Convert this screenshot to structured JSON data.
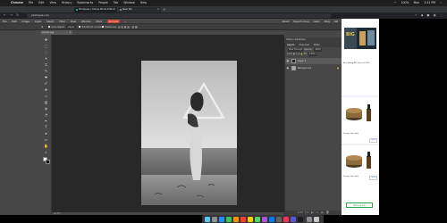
{
  "mac_menubar": {
    "apple": "",
    "items": [
      "Chrome",
      "File",
      "Edit",
      "View",
      "History",
      "Bookmarks",
      "People",
      "Tab",
      "Window",
      "Help"
    ],
    "right_items": [
      "100%",
      "Mon",
      "2:41 PM"
    ]
  },
  "browser": {
    "tabs": [
      {
        "title": "Photopea | Online Photo Editor"
      },
      {
        "title": "New Tab"
      }
    ],
    "url": "photopea.com",
    "colors": {
      "tab_active": "#202124",
      "chrome_dark": "#35363a"
    }
  },
  "photopea": {
    "menu": [
      "File",
      "Edit",
      "Image",
      "Layer",
      "Select",
      "Filter",
      "View",
      "Window",
      "More",
      "Account"
    ],
    "menu_highlighted": "Account",
    "menu_right": [
      "About",
      "Report a bug",
      "Learn",
      "Blog",
      "API"
    ],
    "options": {
      "auto_select": "Auto-Select",
      "layer": "Layer",
      "transform_controls": "Transform controls",
      "distances": "Distances"
    },
    "document_tab": "woman.jpg",
    "panel_tabs": [
      "Layers",
      "Channels",
      "Paths"
    ],
    "side_strip": "History  Swatches",
    "blend_mode": "Pass Through",
    "opacity_label": "Opacity:",
    "opacity_value": "100%",
    "lock_label": "Lock:",
    "fill_label": "Fill:",
    "fill_value": "100%",
    "layers": [
      {
        "name": "Layer 1"
      },
      {
        "name": "Background"
      }
    ],
    "status": "41.3%",
    "accent_color": "#c83f2e",
    "panel_bottom_icons": "eff fx ◐ ▭ ▤ 🗑"
  },
  "ads": {
    "top_caption": "Best Selling BRC Items of 2020",
    "ad1_caption": "Lussory Luxe Skin",
    "ad1_button": "Open",
    "ad2_caption": "Lussory Luxe Skin",
    "ad2_button": "Open",
    "green_button": "Remove Ads"
  },
  "icons": {
    "tools": [
      "move-icon",
      "marquee-icon",
      "lasso-icon",
      "magic-wand-icon",
      "crop-icon",
      "eyedropper-icon",
      "healing-icon",
      "brush-icon",
      "clone-icon",
      "eraser-icon",
      "gradient-icon",
      "blur-icon",
      "dodge-icon",
      "pen-icon",
      "type-icon",
      "path-select-icon",
      "shape-icon",
      "hand-icon",
      "zoom-icon"
    ]
  }
}
